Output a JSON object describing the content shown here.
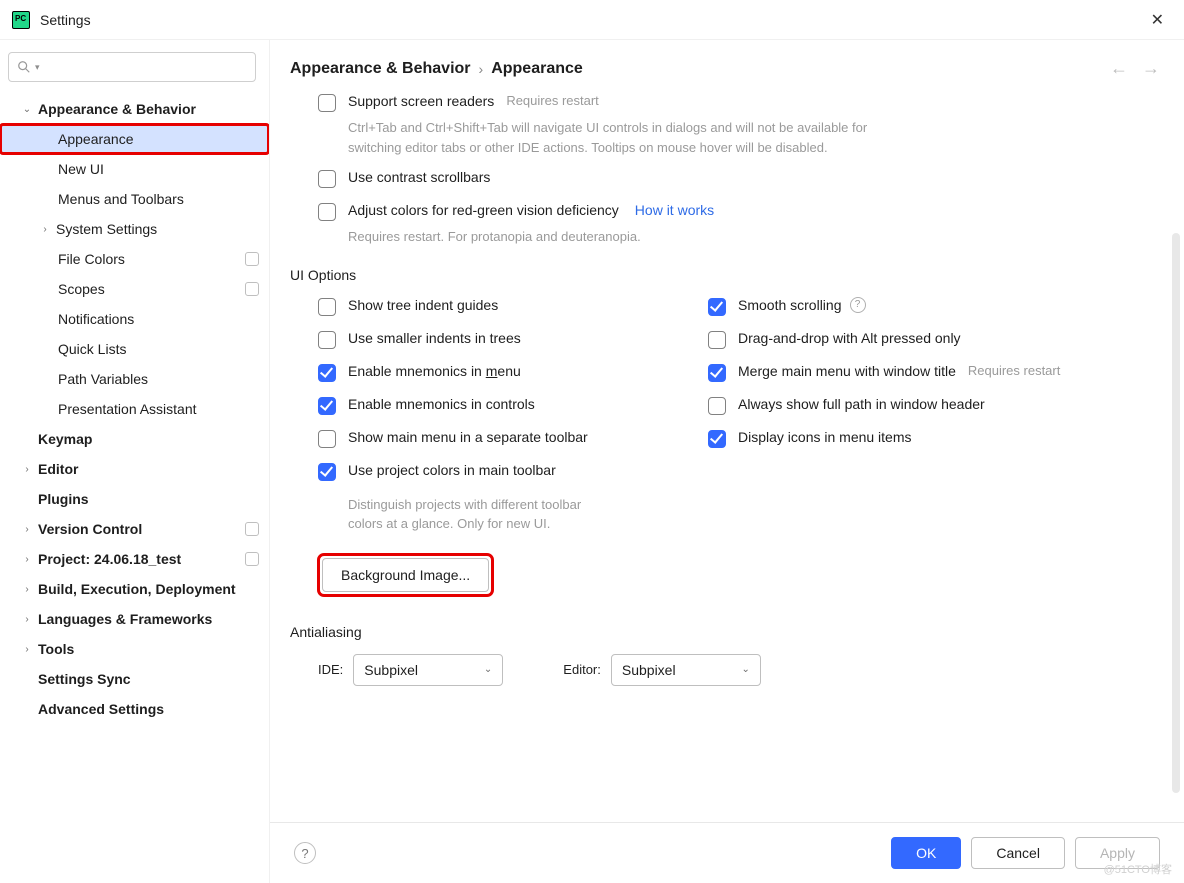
{
  "window": {
    "title": "Settings"
  },
  "breadcrumbs": {
    "parent": "Appearance & Behavior",
    "current": "Appearance"
  },
  "sidebar": {
    "search_placeholder": "",
    "items": [
      {
        "label": "Appearance & Behavior",
        "bold": true,
        "expandable": true,
        "open": true
      },
      {
        "label": "Appearance",
        "child": true,
        "selected": true,
        "highlight": true
      },
      {
        "label": "New UI",
        "child": true
      },
      {
        "label": "Menus and Toolbars",
        "child": true
      },
      {
        "label": "System Settings",
        "child": true,
        "expandable": true,
        "grandchild_exp": true
      },
      {
        "label": "File Colors",
        "child": true,
        "badge": true
      },
      {
        "label": "Scopes",
        "child": true,
        "badge": true
      },
      {
        "label": "Notifications",
        "child": true
      },
      {
        "label": "Quick Lists",
        "child": true
      },
      {
        "label": "Path Variables",
        "child": true
      },
      {
        "label": "Presentation Assistant",
        "child": true
      },
      {
        "label": "Keymap",
        "bold": true
      },
      {
        "label": "Editor",
        "bold": true,
        "expandable": true
      },
      {
        "label": "Plugins",
        "bold": true
      },
      {
        "label": "Version Control",
        "bold": true,
        "expandable": true,
        "badge": true
      },
      {
        "label": "Project: 24.06.18_test",
        "bold": true,
        "expandable": true,
        "badge": true
      },
      {
        "label": "Build, Execution, Deployment",
        "bold": true,
        "expandable": true
      },
      {
        "label": "Languages & Frameworks",
        "bold": true,
        "expandable": true
      },
      {
        "label": "Tools",
        "bold": true,
        "expandable": true
      },
      {
        "label": "Settings Sync",
        "bold": true
      },
      {
        "label": "Advanced Settings",
        "bold": true
      }
    ]
  },
  "accessibility": {
    "screen_readers": {
      "label": "Support screen readers",
      "hint": "Requires restart",
      "desc": "Ctrl+Tab and Ctrl+Shift+Tab will navigate UI controls in dialogs and will not be available for switching editor tabs or other IDE actions. Tooltips on mouse hover will be disabled."
    },
    "contrast": {
      "label": "Use contrast scrollbars"
    },
    "color_def": {
      "label": "Adjust colors for red-green vision deficiency",
      "link": "How it works",
      "desc": "Requires restart. For protanopia and deuteranopia."
    }
  },
  "ui_options": {
    "title": "UI Options",
    "left": [
      {
        "label": "Show tree indent guides",
        "checked": false
      },
      {
        "label": "Use smaller indents in trees",
        "checked": false
      },
      {
        "label_pre": "Enable mnemonics in ",
        "mn": "m",
        "label_post": "enu",
        "checked": true
      },
      {
        "label": "Enable mnemonics in controls",
        "checked": true
      },
      {
        "label": "Show main menu in a separate toolbar",
        "checked": false
      },
      {
        "label": "Use project colors in main toolbar",
        "checked": true,
        "desc": "Distinguish projects with different toolbar colors at a glance. Only for new UI."
      }
    ],
    "right": [
      {
        "label": "Smooth scrolling",
        "checked": true,
        "help": true
      },
      {
        "label": "Drag-and-drop with Alt pressed only",
        "checked": false
      },
      {
        "label": "Merge main menu with window title",
        "checked": true,
        "hint": "Requires restart"
      },
      {
        "label": "Always show full path in window header",
        "checked": false
      },
      {
        "label": "Display icons in menu items",
        "checked": true
      }
    ],
    "bg_button": "Background Image..."
  },
  "antialiasing": {
    "title": "Antialiasing",
    "ide_label": "IDE:",
    "ide_value": "Subpixel",
    "editor_label": "Editor:",
    "editor_value": "Subpixel"
  },
  "footer": {
    "ok": "OK",
    "cancel": "Cancel",
    "apply": "Apply"
  },
  "watermark": "@51CTO博客"
}
